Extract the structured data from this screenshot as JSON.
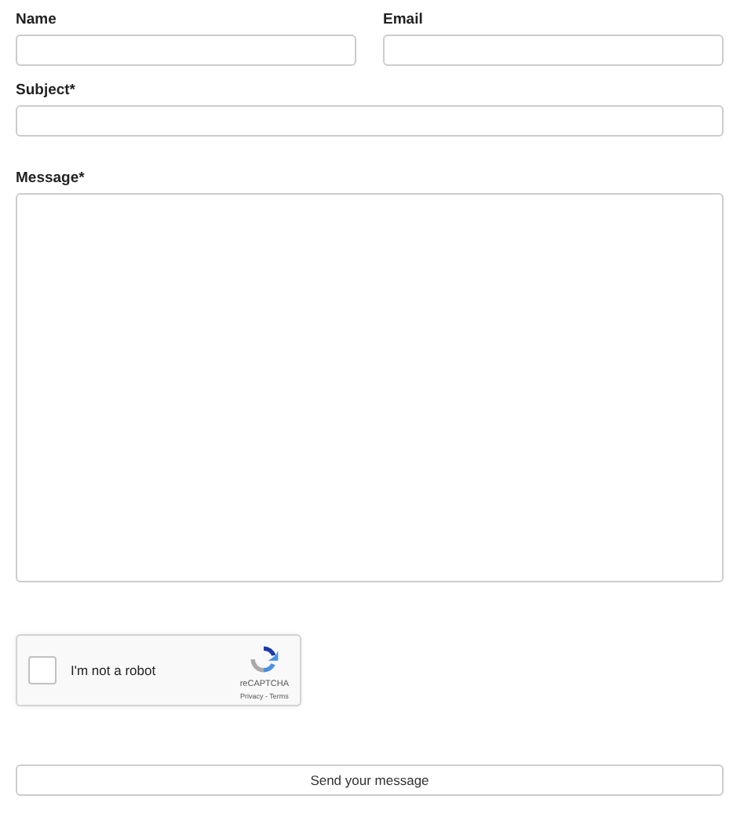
{
  "fields": [
    {
      "label": "Name",
      "kind": "input"
    },
    {
      "label": "Email",
      "kind": "input"
    }
  ],
  "subject": {
    "label": "Subject*",
    "kind": "input"
  },
  "message": {
    "label": "Message*",
    "kind": "textarea"
  },
  "captcha": {
    "label": "I'm not a robot",
    "checked": false,
    "brand": "reCAPTCHA",
    "links": "Privacy - Terms"
  },
  "submit": "Send your message"
}
